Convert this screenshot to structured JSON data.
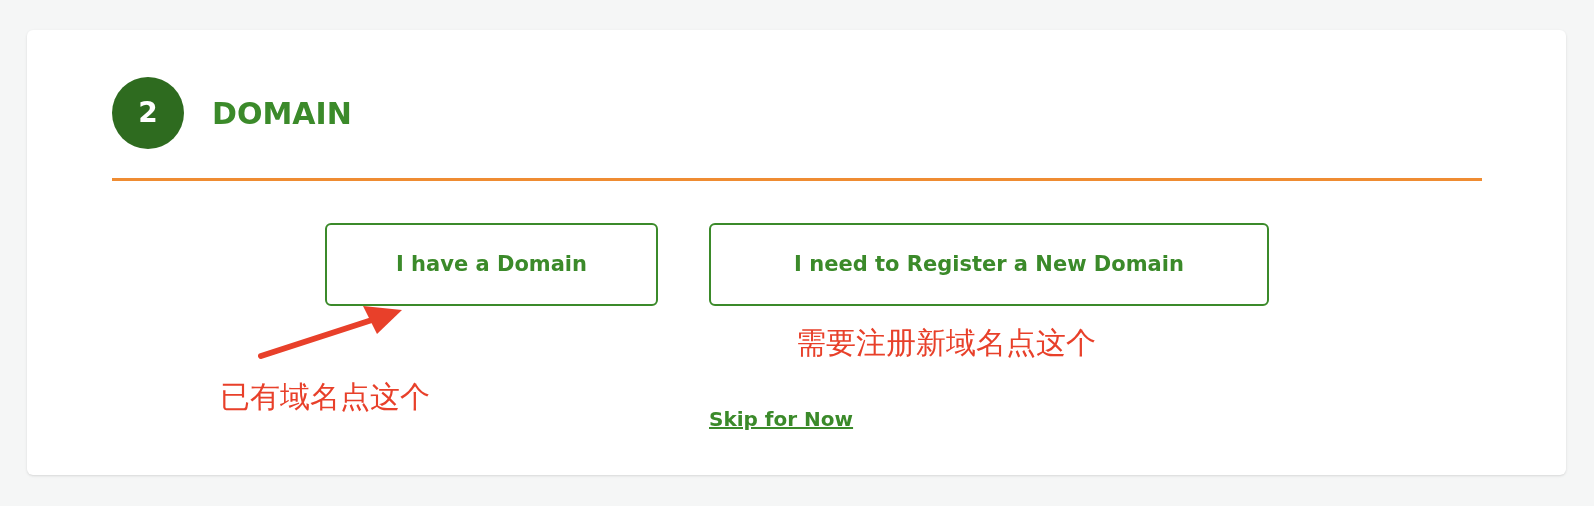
{
  "step": {
    "number": "2",
    "title": "DOMAIN"
  },
  "buttons": [
    {
      "label": "I have a Domain"
    },
    {
      "label": "I need to Register a New Domain"
    }
  ],
  "skip_link": "Skip for Now",
  "annotations": [
    {
      "text": "需要注册新域名点这个"
    },
    {
      "text": "已有域名点这个"
    }
  ]
}
